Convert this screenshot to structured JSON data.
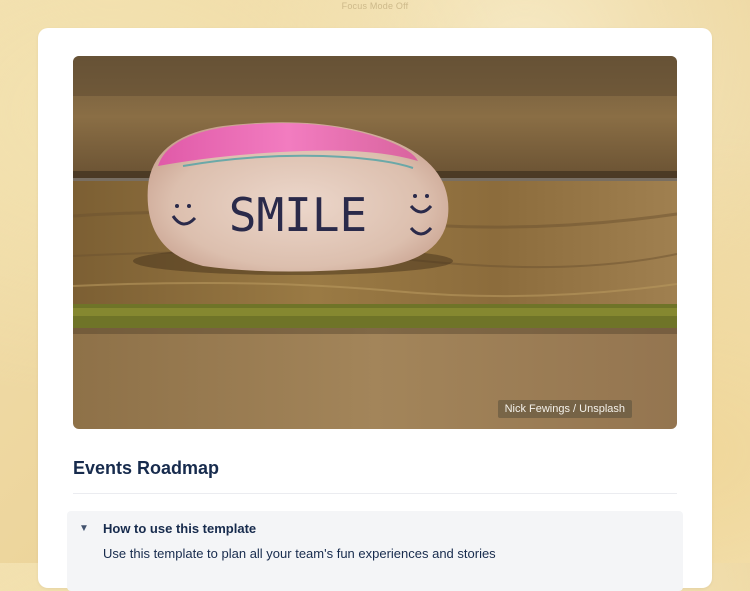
{
  "focus_mode": {
    "label": "Focus Mode Off"
  },
  "cover": {
    "credit": "Nick Fewings / Unsplash",
    "stone_text": "SMILE"
  },
  "page": {
    "title": "Events Roadmap"
  },
  "expand": {
    "title": "How to use this template",
    "caret": "▼",
    "body": "Use this template to plan all your team's fun experiences and stories"
  }
}
